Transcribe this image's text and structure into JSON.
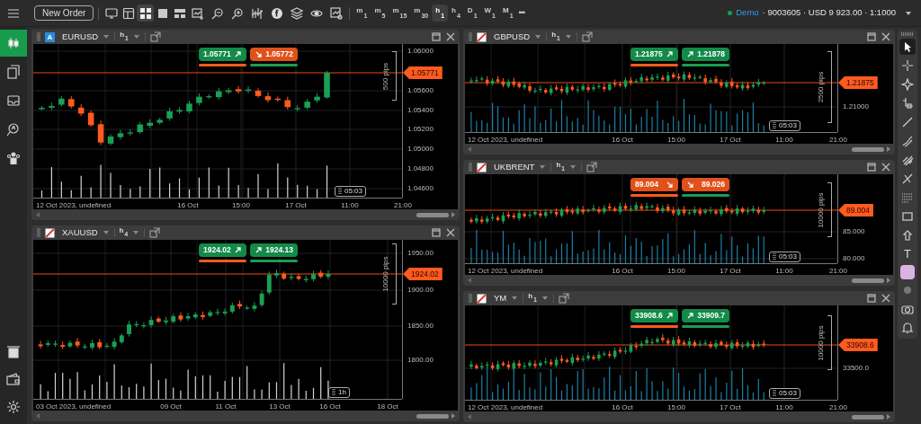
{
  "toolbar": {
    "new_order": "New Order",
    "layouts": [
      {
        "selected": false
      },
      {
        "selected": true
      },
      {
        "selected": false
      },
      {
        "selected": false
      }
    ],
    "timeframes": [
      {
        "unit": "m",
        "count": "1",
        "selected": false
      },
      {
        "unit": "m",
        "count": "5",
        "selected": false
      },
      {
        "unit": "m",
        "count": "15",
        "selected": false
      },
      {
        "unit": "m",
        "count": "30",
        "selected": false
      },
      {
        "unit": "h",
        "count": "1",
        "selected": true
      },
      {
        "unit": "h",
        "count": "4",
        "selected": false
      },
      {
        "unit": "D",
        "count": "1",
        "selected": false
      },
      {
        "unit": "W",
        "count": "1",
        "selected": false
      },
      {
        "unit": "M",
        "count": "1",
        "selected": false
      }
    ],
    "more": "•••"
  },
  "account": {
    "connected": true,
    "mode": "Demo",
    "details": "· 9003605 · USD 9 923.00 · 1:1000"
  },
  "sidebar": {
    "top_items": [
      {
        "kind": "candles",
        "selected": true
      },
      {
        "kind": "documents",
        "selected": false
      },
      {
        "kind": "inbox",
        "selected": false
      },
      {
        "kind": "search",
        "selected": false
      },
      {
        "kind": "users",
        "selected": false
      }
    ],
    "bottom_items": [
      {
        "kind": "deposit",
        "selected": false
      },
      {
        "kind": "wallet",
        "selected": false
      },
      {
        "kind": "settings",
        "selected": false
      }
    ]
  },
  "left_column": [
    {
      "icon": {
        "kind": "letter",
        "label": "A"
      },
      "symbol": "EURUSD",
      "timeframe": {
        "unit": "h",
        "count": "1"
      },
      "quotes": [
        {
          "price": "1.05771",
          "rising": true
        },
        {
          "price": "1.05772",
          "rising": false
        }
      ],
      "price_ticks": [
        "1.06000",
        "1.05600",
        "1.05400",
        "1.05200",
        "1.05000",
        "1.04800",
        "1.04600"
      ],
      "current_price": "1.05771",
      "range": "500 pips",
      "date": "12 Oct 2023, undefined",
      "time_ticks": [
        "16 Oct",
        "15:00",
        "17 Oct",
        "11:00",
        "21:00"
      ],
      "countdown": "05:03"
    },
    {
      "icon": {
        "kind": "slash"
      },
      "symbol": "XAUUSD",
      "timeframe": {
        "unit": "h",
        "count": "4"
      },
      "quotes": [
        {
          "price": "1924.02",
          "rising": true
        },
        {
          "price": "1924.13",
          "rising": true
        }
      ],
      "price_ticks": [
        "1950.00",
        "1900.00",
        "1850.00",
        "1800.00"
      ],
      "current_price": "1924.02",
      "range": "10000 pips",
      "date": "03 Oct 2023, undefined",
      "time_ticks": [
        "09 Oct",
        "11 Oct",
        "13 Oct",
        "16 Oct",
        "18 Oct"
      ],
      "countdown": "1h"
    }
  ],
  "right_column": [
    {
      "icon": {
        "kind": "slash"
      },
      "symbol": "GBPUSD",
      "timeframe": {
        "unit": "h",
        "count": "1"
      },
      "quotes": [
        {
          "price": "1.21875",
          "rising": true
        },
        {
          "price": "1.21878",
          "rising": true
        }
      ],
      "price_ticks": [
        "1.21000"
      ],
      "current_price": "1.21875",
      "range": "2500 pips",
      "date": "12 Oct 2023, undefined",
      "time_ticks": [
        "16 Oct",
        "15:00",
        "17 Oct",
        "11:00",
        "21:00"
      ],
      "countdown": "05:03"
    },
    {
      "icon": {
        "kind": "slash"
      },
      "symbol": "UKBRENT",
      "timeframe": {
        "unit": "h",
        "count": "1"
      },
      "quotes": [
        {
          "price": "89.004",
          "rising": false
        },
        {
          "price": "89.026",
          "rising": false
        }
      ],
      "price_ticks": [
        "85.000",
        "80.000"
      ],
      "current_price": "89.004",
      "range": "10000 pips",
      "date": "12 Oct 2023, undefined",
      "time_ticks": [
        "16 Oct",
        "15:00",
        "17 Oct",
        "11:00",
        "21:00"
      ],
      "countdown": "05:03"
    },
    {
      "icon": {
        "kind": "slash"
      },
      "symbol": "YM",
      "timeframe": {
        "unit": "h",
        "count": "1"
      },
      "quotes": [
        {
          "price": "33908.6",
          "rising": true
        },
        {
          "price": "33909.7",
          "rising": true
        }
      ],
      "price_ticks": [
        "33500.0"
      ],
      "current_price": "33908.6",
      "range": "10000 pips",
      "date": "12 Oct 2023, undefined",
      "time_ticks": [
        "16 Oct",
        "15:00",
        "17 Oct",
        "11:00",
        "21:00"
      ],
      "countdown": "05:03"
    }
  ],
  "drawing_tools": [
    {
      "kind": "cursor",
      "selected": true
    },
    {
      "kind": "crosshair",
      "selected": false
    },
    {
      "kind": "move",
      "selected": false
    },
    {
      "kind": "measure",
      "selected": false
    },
    {
      "kind": "line",
      "selected": false
    },
    {
      "kind": "brush",
      "selected": false
    },
    {
      "kind": "marker",
      "selected": false
    },
    {
      "kind": "fork",
      "selected": false
    },
    {
      "kind": "fib",
      "selected": false
    },
    {
      "kind": "rectangle",
      "selected": false
    },
    {
      "kind": "arrow",
      "selected": false
    },
    {
      "kind": "text",
      "label": "T",
      "selected": false
    },
    {
      "kind": "swatch",
      "color": "#d8b4e2"
    },
    {
      "kind": "dot",
      "selected": false
    },
    {
      "kind": "camera",
      "selected": false
    },
    {
      "kind": "bell",
      "selected": false
    }
  ]
}
